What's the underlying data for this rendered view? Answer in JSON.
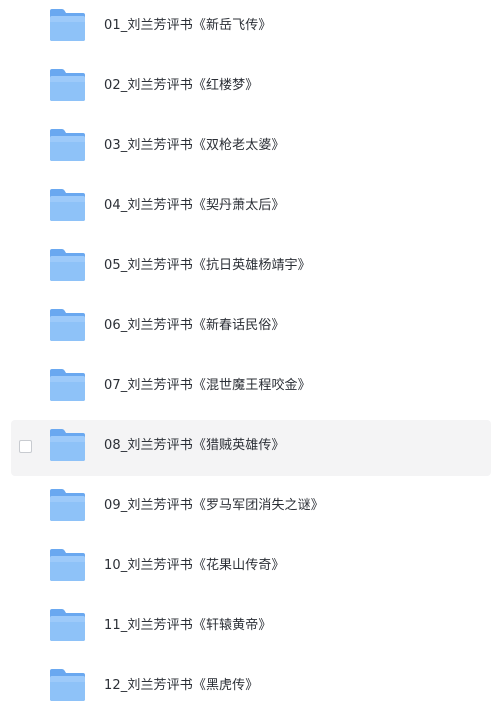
{
  "files": [
    {
      "name": "01_刘兰芳评书《新岳飞传》",
      "icon": "folder-icon",
      "hovered": false
    },
    {
      "name": "02_刘兰芳评书《红楼梦》",
      "icon": "folder-icon",
      "hovered": false
    },
    {
      "name": "03_刘兰芳评书《双枪老太婆》",
      "icon": "folder-icon",
      "hovered": false
    },
    {
      "name": "04_刘兰芳评书《契丹萧太后》",
      "icon": "folder-icon",
      "hovered": false
    },
    {
      "name": "05_刘兰芳评书《抗日英雄杨靖宇》",
      "icon": "folder-icon",
      "hovered": false
    },
    {
      "name": "06_刘兰芳评书《新春话民俗》",
      "icon": "folder-icon",
      "hovered": false
    },
    {
      "name": "07_刘兰芳评书《混世魔王程咬金》",
      "icon": "folder-icon",
      "hovered": false
    },
    {
      "name": "08_刘兰芳评书《猎贼英雄传》",
      "icon": "folder-icon",
      "hovered": true
    },
    {
      "name": "09_刘兰芳评书《罗马军团消失之谜》",
      "icon": "folder-icon",
      "hovered": false
    },
    {
      "name": "10_刘兰芳评书《花果山传奇》",
      "icon": "folder-icon",
      "hovered": false
    },
    {
      "name": "11_刘兰芳评书《轩辕黄帝》",
      "icon": "folder-icon",
      "hovered": false
    },
    {
      "name": "12_刘兰芳评书《黑虎传》",
      "icon": "folder-icon",
      "hovered": false
    }
  ],
  "colors": {
    "folder_back": "#6aa8f0",
    "folder_front": "#8ec2f8",
    "folder_front_light": "#a9d2fb",
    "hover_background": "#f4f4f5",
    "text": "#2b2f36"
  }
}
